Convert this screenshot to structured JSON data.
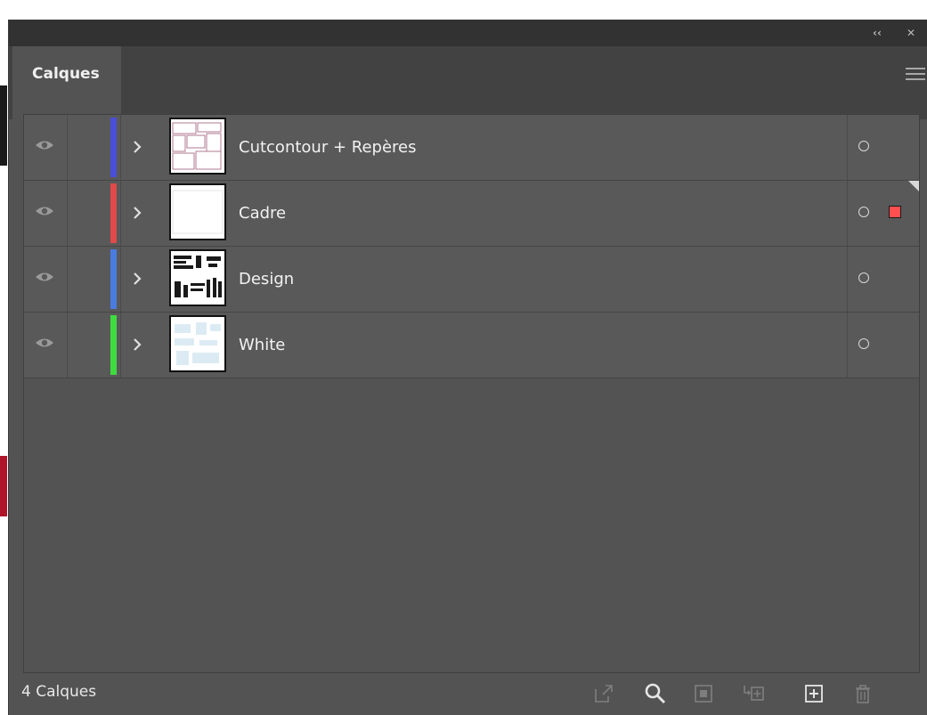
{
  "panel": {
    "tab_label": "Calques",
    "footer_count": "4 Calques"
  },
  "colors": {
    "panel_bg": "#535353",
    "titlebar_bg": "#323232",
    "tabbar_bg": "#424242",
    "selection_square": "#ff4f4f"
  },
  "icons": {
    "collapse": "double-chevron-left-icon",
    "close": "close-icon",
    "menu": "hamburger-menu-icon",
    "visibility": "eye-icon",
    "expand": "chevron-right-icon",
    "target": "target-circle-icon",
    "footer": [
      "export-icon",
      "search-icon",
      "clipping-mask-icon",
      "new-sublayer-icon",
      "new-layer-icon",
      "trash-icon"
    ]
  },
  "layers": [
    {
      "name": "Cutcontour + Repères",
      "color": "#4a4ed8",
      "selected_art": false
    },
    {
      "name": "Cadre",
      "color": "#e04a4a",
      "selected_art": true
    },
    {
      "name": "Design",
      "color": "#4a7ce0",
      "selected_art": false
    },
    {
      "name": "White",
      "color": "#3fdc3f",
      "selected_art": false
    }
  ]
}
